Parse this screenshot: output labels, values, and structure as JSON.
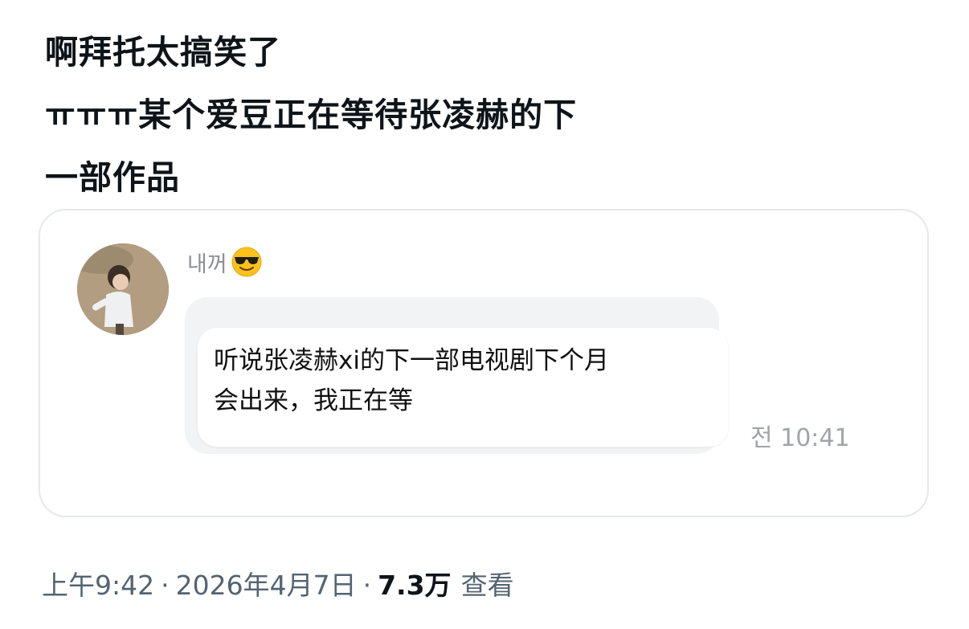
{
  "post": {
    "lines": [
      "啊拜托太搞笑了",
      "ㅠㅠㅠ某个爱豆正在等待张凌赫的下",
      "一部作品"
    ]
  },
  "quoted_message": {
    "sender_name": "내꺼",
    "emoji_icon": "smiling-face-with-sunglasses-icon",
    "message_lines": [
      "听说张凌赫xi的下一部电视剧下个月",
      "会出来，我正在等"
    ],
    "time": "전 10:41"
  },
  "meta": {
    "time": "上午9:42",
    "separator": "·",
    "date": "2026年4月7日",
    "views_count": "7.3万",
    "views_label": "查看"
  },
  "colors": {
    "text_primary": "#0f1419",
    "text_secondary": "#536471",
    "card_border": "#e6e8ea",
    "bubble_bg": "#f2f3f4"
  }
}
